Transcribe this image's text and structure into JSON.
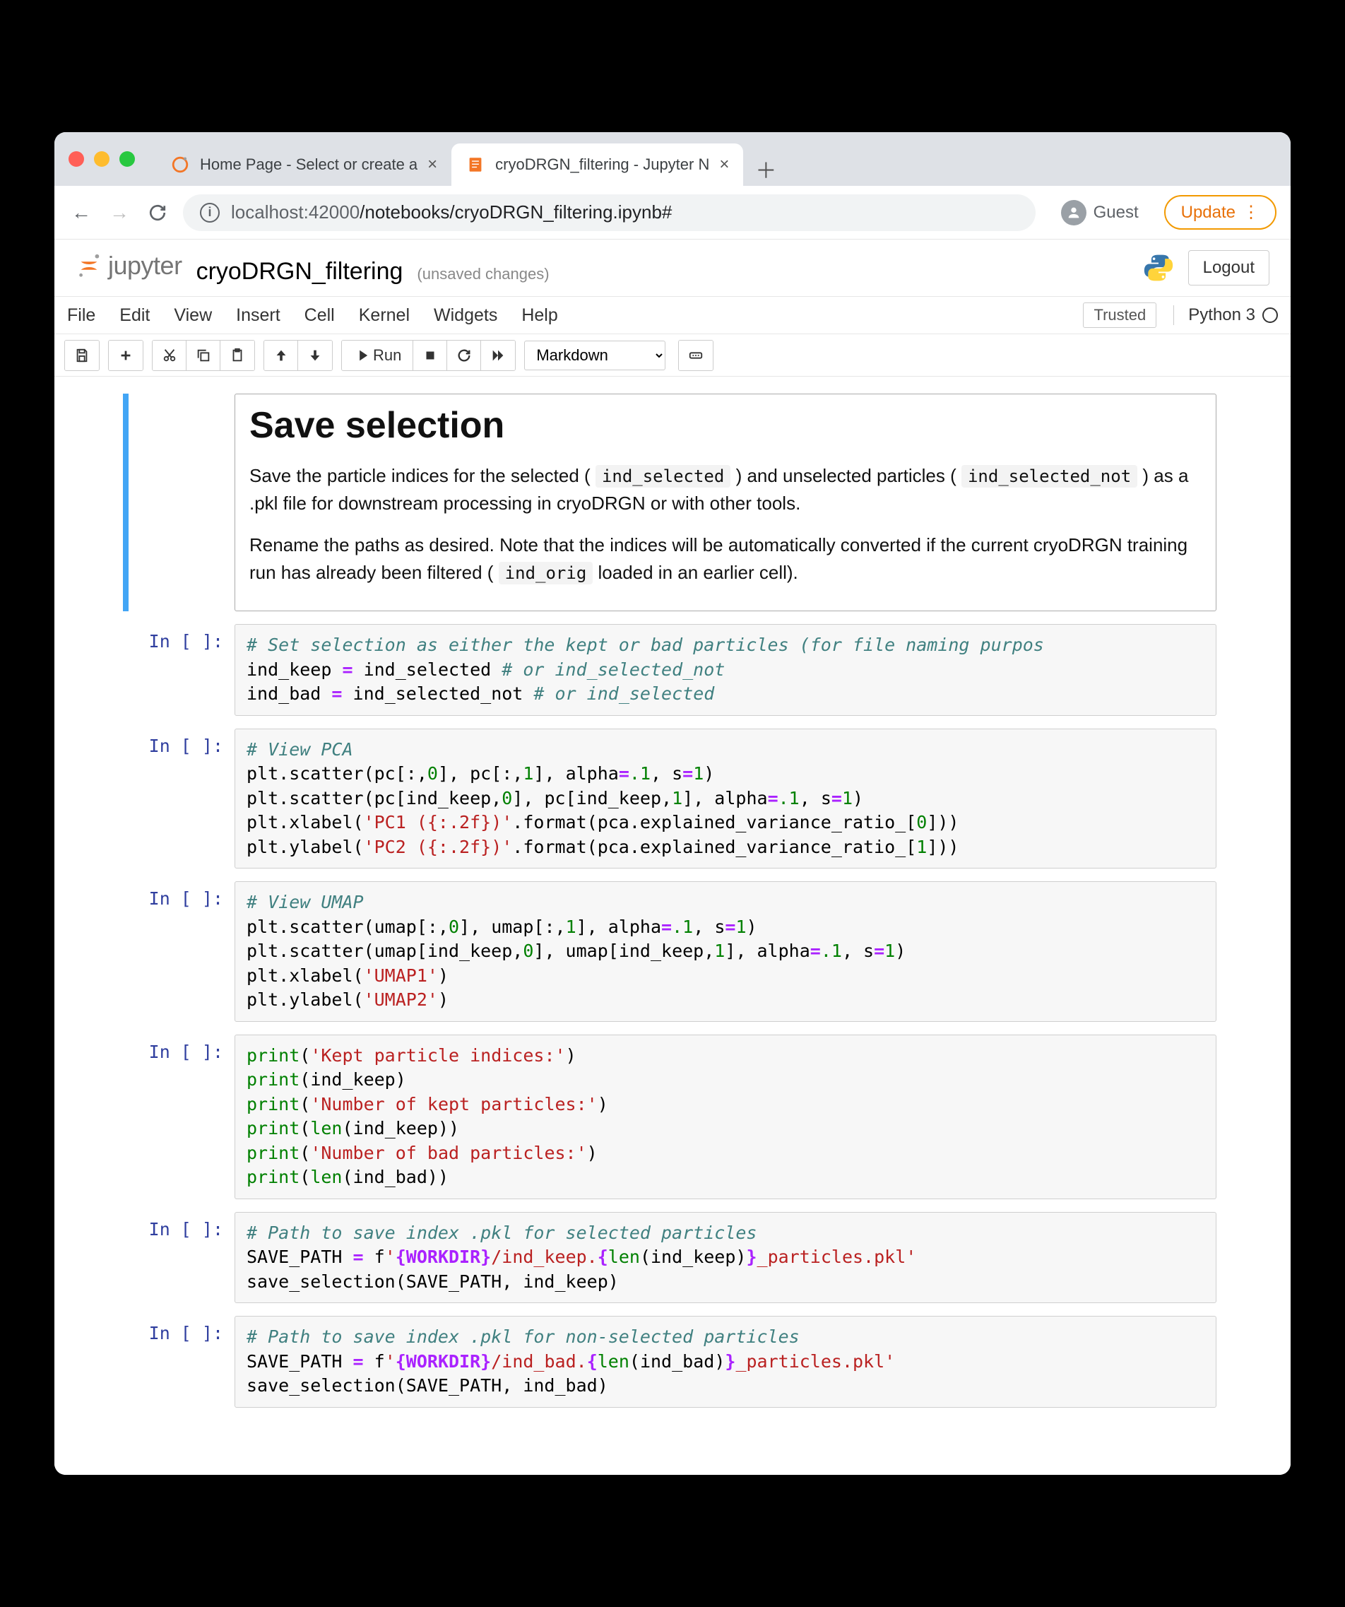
{
  "browser": {
    "tabs": [
      {
        "title": "Home Page - Select or create a",
        "active": false
      },
      {
        "title": "cryoDRGN_filtering - Jupyter N",
        "active": true
      }
    ],
    "url_host": "localhost",
    "url_port": ":42000",
    "url_path": "/notebooks/cryoDRGN_filtering.ipynb#",
    "guest_label": "Guest",
    "update_label": "Update"
  },
  "jupyter": {
    "brand": "jupyter",
    "notebook_name": "cryoDRGN_filtering",
    "autosave": "(unsaved changes)",
    "logout": "Logout",
    "menus": [
      "File",
      "Edit",
      "View",
      "Insert",
      "Cell",
      "Kernel",
      "Widgets",
      "Help"
    ],
    "trusted": "Trusted",
    "kernel_name": "Python 3",
    "toolbar": {
      "run_label": "Run",
      "cell_type": "Markdown"
    }
  },
  "markdown_cell": {
    "heading": "Save selection",
    "p1_before": "Save the particle indices for the selected (",
    "p1_code1": "ind_selected",
    "p1_mid": ") and unselected particles (",
    "p1_code2": "ind_selected_not",
    "p1_after": ") as a .pkl file for downstream processing in cryoDRGN or with other tools.",
    "p2_before": "Rename the paths as desired. Note that the indices will be automatically converted if the current cryoDRGN training run has already been filtered (",
    "p2_code": "ind_orig",
    "p2_after": " loaded in an earlier cell)."
  },
  "prompts": {
    "empty": "In [ ]:"
  },
  "code": {
    "c1": {
      "l1_comment": "# Set selection as either the kept or bad particles (for file naming purpos",
      "l2_a": "ind_keep ",
      "l2_op": "=",
      "l2_b": " ind_selected ",
      "l2_c": "# or ind_selected_not",
      "l3_a": "ind_bad ",
      "l3_op": "=",
      "l3_b": " ind_selected_not ",
      "l3_c": "# or ind_selected"
    },
    "c2": {
      "l1": "# View PCA",
      "l2": {
        "p": "plt.scatter(pc[:,",
        "n0": "0",
        "m": "], pc[:,",
        "n1": "1",
        "e": "], alpha",
        "op": "=",
        "v1": ".1",
        "s": ", s",
        "op2": "=",
        "v2": "1",
        "end": ")"
      },
      "l3": {
        "p": "plt.scatter(pc[ind_keep,",
        "n0": "0",
        "m": "], pc[ind_keep,",
        "n1": "1",
        "e": "], alpha",
        "op": "=",
        "v1": ".1",
        "s": ", s",
        "op2": "=",
        "v2": "1",
        "end": ")"
      },
      "l4": {
        "p": "plt.xlabel(",
        "s": "'PC1 ({:.2f})'",
        "m": ".format(pca.explained_variance_ratio_[",
        "n": "0",
        "e": "]))"
      },
      "l5": {
        "p": "plt.ylabel(",
        "s": "'PC2 ({:.2f})'",
        "m": ".format(pca.explained_variance_ratio_[",
        "n": "1",
        "e": "]))"
      }
    },
    "c3": {
      "l1": "# View UMAP",
      "l2": {
        "p": "plt.scatter(umap[:,",
        "n0": "0",
        "m": "], umap[:,",
        "n1": "1",
        "e": "], alpha",
        "op": "=",
        "v1": ".1",
        "s": ", s",
        "op2": "=",
        "v2": "1",
        "end": ")"
      },
      "l3": {
        "p": "plt.scatter(umap[ind_keep,",
        "n0": "0",
        "m": "], umap[ind_keep,",
        "n1": "1",
        "e": "], alpha",
        "op": "=",
        "v1": ".1",
        "s": ", s",
        "op2": "=",
        "v2": "1",
        "end": ")"
      },
      "l4": {
        "p": "plt.xlabel(",
        "s": "'UMAP1'",
        "e": ")"
      },
      "l5": {
        "p": "plt.ylabel(",
        "s": "'UMAP2'",
        "e": ")"
      }
    },
    "c4": {
      "l1": {
        "p": "print",
        "a": "(",
        "s": "'Kept particle indices:'",
        "e": ")"
      },
      "l2": {
        "p": "print",
        "a": "(ind_keep)"
      },
      "l3": {
        "p": "print",
        "a": "(",
        "s": "'Number of kept particles:'",
        "e": ")"
      },
      "l4": {
        "p": "print",
        "a": "(",
        "b": "len",
        "c": "(ind_keep))"
      },
      "l5": {
        "p": "print",
        "a": "(",
        "s": "'Number of bad particles:'",
        "e": ")"
      },
      "l6": {
        "p": "print",
        "a": "(",
        "b": "len",
        "c": "(ind_bad))"
      }
    },
    "c5": {
      "l1": "# Path to save index .pkl for selected particles",
      "l2": {
        "a": "SAVE_PATH ",
        "op": "=",
        "sp": " f",
        "q": "'",
        "s1": "{WORKDIR}",
        "t1": "/ind_keep.",
        "s2": "{",
        "fn": "len",
        "arg": "(ind_keep)",
        "s2e": "}",
        "t2": "_particles.pkl",
        "qe": "'"
      },
      "l3": {
        "a": "save_selection(SAVE_PATH, ind_keep)"
      }
    },
    "c6": {
      "l1": "# Path to save index .pkl for non-selected particles",
      "l2": {
        "a": "SAVE_PATH ",
        "op": "=",
        "sp": " f",
        "q": "'",
        "s1": "{WORKDIR}",
        "t1": "/ind_bad.",
        "s2": "{",
        "fn": "len",
        "arg": "(ind_bad)",
        "s2e": "}",
        "t2": "_particles.pkl",
        "qe": "'"
      },
      "l3": {
        "a": "save_selection(SAVE_PATH, ind_bad)"
      }
    }
  }
}
